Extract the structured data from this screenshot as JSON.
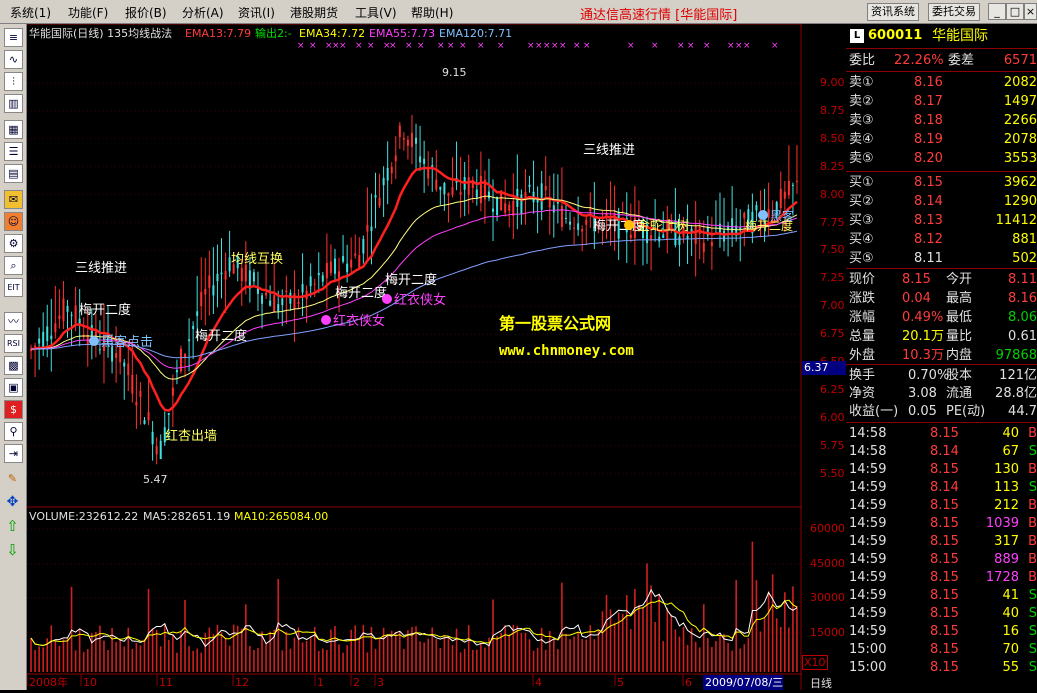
{
  "menu": {
    "items": [
      "系统(1)",
      "功能(F)",
      "报价(B)",
      "分析(A)",
      "资讯(I)",
      "港股期货",
      "工具(V)",
      "帮助(H)"
    ],
    "title": "通达信高速行情 [华能国际]",
    "btn_info": "资讯系统",
    "btn_trade": "委托交易"
  },
  "chart": {
    "header": "华能国际(日线) 135均线战法",
    "ema13": "EMA13:7.79",
    "out2": "输出2:-",
    "ema34": "EMA34:7.72",
    "ema55": "EMA55:7.73",
    "ema120": "EMA120:7.71",
    "high_label": "9.15",
    "low_label": "5.47",
    "watermark1": "第一股票公式网",
    "watermark2": "www.chnmoney.com",
    "cur_price": "6.37",
    "volume_header": "VOLUME:232612.22",
    "ma5": "MA5:282651.19",
    "ma10": "MA10:265084.00",
    "vol_unit": "X10",
    "date_sel": "2009/07/08/三",
    "period": "日线",
    "annotations": {
      "a1": "三线推进",
      "a2": "梅开二度",
      "a3": "黑客点击",
      "a4": "红杏出墙",
      "a5": "梅开二度",
      "a6": "均线互换",
      "a7": "红衣侠女",
      "a8": "梅开二度",
      "a9": "红衣侠女",
      "a10": "梅开二度",
      "a11": "三线推进",
      "a12": "梅开二度",
      "a13": "金蛇上树",
      "a14": "黑客",
      "a15": "梅开二度"
    },
    "x_labels": [
      "2008年",
      "10",
      "11",
      "12",
      "1",
      "2",
      "3",
      "4",
      "5",
      "6"
    ],
    "price_axis": [
      "9.00",
      "8.75",
      "8.50",
      "8.25",
      "8.00",
      "7.75",
      "7.50",
      "7.25",
      "7.00",
      "6.75",
      "6.50",
      "6.25",
      "6.00",
      "5.75",
      "5.50"
    ],
    "vol_axis": [
      "60000",
      "45000",
      "30000",
      "15000"
    ]
  },
  "quote": {
    "code": "600011",
    "name": "华能国际",
    "logo": "L",
    "weibi_label": "委比",
    "weibi": "22.26%",
    "weicha_label": "委差",
    "weicha": "6571",
    "asks": [
      {
        "label": "卖⑤",
        "price": "8.20",
        "vol": "3553"
      },
      {
        "label": "卖④",
        "price": "8.19",
        "vol": "2078"
      },
      {
        "label": "卖③",
        "price": "8.18",
        "vol": "2266"
      },
      {
        "label": "卖②",
        "price": "8.17",
        "vol": "1497"
      },
      {
        "label": "卖①",
        "price": "8.16",
        "vol": "2082"
      }
    ],
    "bids": [
      {
        "label": "买①",
        "price": "8.15",
        "vol": "3962"
      },
      {
        "label": "买②",
        "price": "8.14",
        "vol": "1290"
      },
      {
        "label": "买③",
        "price": "8.13",
        "vol": "11412"
      },
      {
        "label": "买④",
        "price": "8.12",
        "vol": "881"
      },
      {
        "label": "买⑤",
        "price": "8.11",
        "vol": "502"
      }
    ],
    "stats": [
      {
        "l1": "现价",
        "v1": "8.15",
        "l2": "今开",
        "v2": "8.11"
      },
      {
        "l1": "涨跌",
        "v1": "0.04",
        "l2": "最高",
        "v2": "8.16"
      },
      {
        "l1": "涨幅",
        "v1": "0.49%",
        "l2": "最低",
        "v2": "8.06"
      },
      {
        "l1": "总量",
        "v1": "20.1万",
        "l2": "量比",
        "v2": "0.61"
      },
      {
        "l1": "外盘",
        "v1": "10.3万",
        "l2": "内盘",
        "v2": "97868"
      }
    ],
    "stats2": [
      {
        "l1": "换手",
        "v1": "0.70%",
        "l2": "股本",
        "v2": "121亿"
      },
      {
        "l1": "净资",
        "v1": "3.08",
        "l2": "流通",
        "v2": "28.8亿"
      },
      {
        "l1": "收益(一)",
        "v1": "0.05",
        "l2": "PE(动)",
        "v2": "44.7"
      }
    ],
    "ticks": [
      {
        "t": "14:58",
        "p": "8.15",
        "v": "40",
        "s": "B"
      },
      {
        "t": "14:58",
        "p": "8.14",
        "v": "67",
        "s": "S"
      },
      {
        "t": "14:59",
        "p": "8.15",
        "v": "130",
        "s": "B"
      },
      {
        "t": "14:59",
        "p": "8.14",
        "v": "113",
        "s": "S"
      },
      {
        "t": "14:59",
        "p": "8.15",
        "v": "212",
        "s": "B"
      },
      {
        "t": "14:59",
        "p": "8.15",
        "v": "1039",
        "s": "B"
      },
      {
        "t": "14:59",
        "p": "8.15",
        "v": "317",
        "s": "B"
      },
      {
        "t": "14:59",
        "p": "8.15",
        "v": "889",
        "s": "B"
      },
      {
        "t": "14:59",
        "p": "8.15",
        "v": "1728",
        "s": "B"
      },
      {
        "t": "14:59",
        "p": "8.15",
        "v": "41",
        "s": "S"
      },
      {
        "t": "14:59",
        "p": "8.15",
        "v": "40",
        "s": "S"
      },
      {
        "t": "14:59",
        "p": "8.15",
        "v": "16",
        "s": "S"
      },
      {
        "t": "15:00",
        "p": "8.15",
        "v": "70",
        "s": "S"
      },
      {
        "t": "15:00",
        "p": "8.15",
        "v": "55",
        "s": "S"
      }
    ]
  }
}
